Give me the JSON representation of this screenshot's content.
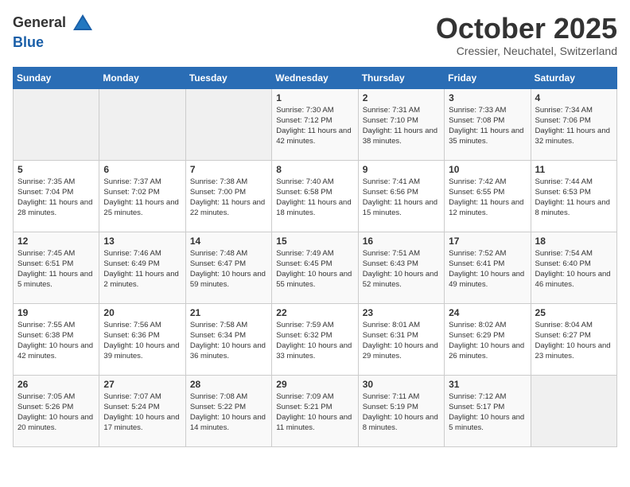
{
  "header": {
    "logo_general": "General",
    "logo_blue": "Blue",
    "month": "October 2025",
    "location": "Cressier, Neuchatel, Switzerland"
  },
  "days_of_week": [
    "Sunday",
    "Monday",
    "Tuesday",
    "Wednesday",
    "Thursday",
    "Friday",
    "Saturday"
  ],
  "weeks": [
    [
      {
        "day": "",
        "info": ""
      },
      {
        "day": "",
        "info": ""
      },
      {
        "day": "",
        "info": ""
      },
      {
        "day": "1",
        "info": "Sunrise: 7:30 AM\nSunset: 7:12 PM\nDaylight: 11 hours and 42 minutes."
      },
      {
        "day": "2",
        "info": "Sunrise: 7:31 AM\nSunset: 7:10 PM\nDaylight: 11 hours and 38 minutes."
      },
      {
        "day": "3",
        "info": "Sunrise: 7:33 AM\nSunset: 7:08 PM\nDaylight: 11 hours and 35 minutes."
      },
      {
        "day": "4",
        "info": "Sunrise: 7:34 AM\nSunset: 7:06 PM\nDaylight: 11 hours and 32 minutes."
      }
    ],
    [
      {
        "day": "5",
        "info": "Sunrise: 7:35 AM\nSunset: 7:04 PM\nDaylight: 11 hours and 28 minutes."
      },
      {
        "day": "6",
        "info": "Sunrise: 7:37 AM\nSunset: 7:02 PM\nDaylight: 11 hours and 25 minutes."
      },
      {
        "day": "7",
        "info": "Sunrise: 7:38 AM\nSunset: 7:00 PM\nDaylight: 11 hours and 22 minutes."
      },
      {
        "day": "8",
        "info": "Sunrise: 7:40 AM\nSunset: 6:58 PM\nDaylight: 11 hours and 18 minutes."
      },
      {
        "day": "9",
        "info": "Sunrise: 7:41 AM\nSunset: 6:56 PM\nDaylight: 11 hours and 15 minutes."
      },
      {
        "day": "10",
        "info": "Sunrise: 7:42 AM\nSunset: 6:55 PM\nDaylight: 11 hours and 12 minutes."
      },
      {
        "day": "11",
        "info": "Sunrise: 7:44 AM\nSunset: 6:53 PM\nDaylight: 11 hours and 8 minutes."
      }
    ],
    [
      {
        "day": "12",
        "info": "Sunrise: 7:45 AM\nSunset: 6:51 PM\nDaylight: 11 hours and 5 minutes."
      },
      {
        "day": "13",
        "info": "Sunrise: 7:46 AM\nSunset: 6:49 PM\nDaylight: 11 hours and 2 minutes."
      },
      {
        "day": "14",
        "info": "Sunrise: 7:48 AM\nSunset: 6:47 PM\nDaylight: 10 hours and 59 minutes."
      },
      {
        "day": "15",
        "info": "Sunrise: 7:49 AM\nSunset: 6:45 PM\nDaylight: 10 hours and 55 minutes."
      },
      {
        "day": "16",
        "info": "Sunrise: 7:51 AM\nSunset: 6:43 PM\nDaylight: 10 hours and 52 minutes."
      },
      {
        "day": "17",
        "info": "Sunrise: 7:52 AM\nSunset: 6:41 PM\nDaylight: 10 hours and 49 minutes."
      },
      {
        "day": "18",
        "info": "Sunrise: 7:54 AM\nSunset: 6:40 PM\nDaylight: 10 hours and 46 minutes."
      }
    ],
    [
      {
        "day": "19",
        "info": "Sunrise: 7:55 AM\nSunset: 6:38 PM\nDaylight: 10 hours and 42 minutes."
      },
      {
        "day": "20",
        "info": "Sunrise: 7:56 AM\nSunset: 6:36 PM\nDaylight: 10 hours and 39 minutes."
      },
      {
        "day": "21",
        "info": "Sunrise: 7:58 AM\nSunset: 6:34 PM\nDaylight: 10 hours and 36 minutes."
      },
      {
        "day": "22",
        "info": "Sunrise: 7:59 AM\nSunset: 6:32 PM\nDaylight: 10 hours and 33 minutes."
      },
      {
        "day": "23",
        "info": "Sunrise: 8:01 AM\nSunset: 6:31 PM\nDaylight: 10 hours and 29 minutes."
      },
      {
        "day": "24",
        "info": "Sunrise: 8:02 AM\nSunset: 6:29 PM\nDaylight: 10 hours and 26 minutes."
      },
      {
        "day": "25",
        "info": "Sunrise: 8:04 AM\nSunset: 6:27 PM\nDaylight: 10 hours and 23 minutes."
      }
    ],
    [
      {
        "day": "26",
        "info": "Sunrise: 7:05 AM\nSunset: 5:26 PM\nDaylight: 10 hours and 20 minutes."
      },
      {
        "day": "27",
        "info": "Sunrise: 7:07 AM\nSunset: 5:24 PM\nDaylight: 10 hours and 17 minutes."
      },
      {
        "day": "28",
        "info": "Sunrise: 7:08 AM\nSunset: 5:22 PM\nDaylight: 10 hours and 14 minutes."
      },
      {
        "day": "29",
        "info": "Sunrise: 7:09 AM\nSunset: 5:21 PM\nDaylight: 10 hours and 11 minutes."
      },
      {
        "day": "30",
        "info": "Sunrise: 7:11 AM\nSunset: 5:19 PM\nDaylight: 10 hours and 8 minutes."
      },
      {
        "day": "31",
        "info": "Sunrise: 7:12 AM\nSunset: 5:17 PM\nDaylight: 10 hours and 5 minutes."
      },
      {
        "day": "",
        "info": ""
      }
    ]
  ]
}
